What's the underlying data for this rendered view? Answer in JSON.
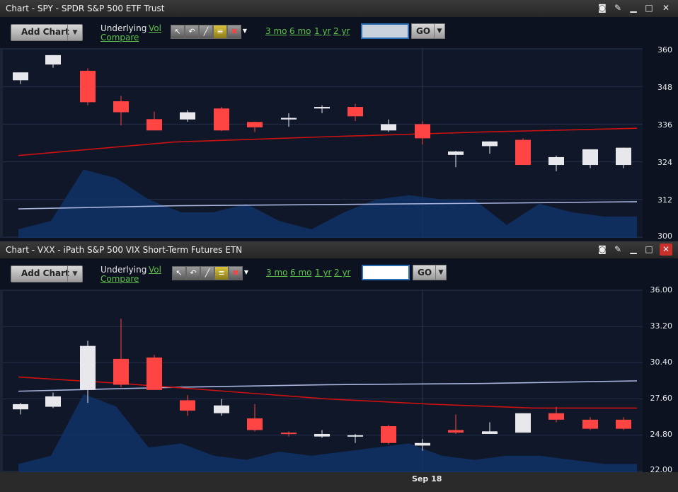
{
  "panels": [
    {
      "title": "Chart - SPY - SPDR S&P 500 ETF Trust",
      "add_chart": "Add Chart",
      "underlying": "Underlying",
      "vol": "Vol",
      "compare": "Compare",
      "periods": [
        "3 mo",
        "6 mo",
        "1 yr",
        "2 yr"
      ],
      "symbol_value": "",
      "go": "GO",
      "y_ticks": [
        "360",
        "348",
        "336",
        "324",
        "312",
        "300"
      ]
    },
    {
      "title": "Chart - VXX - iPath S&P 500 VIX Short-Term Futures ETN",
      "add_chart": "Add Chart",
      "underlying": "Underlying",
      "vol": "Vol",
      "compare": "Compare",
      "periods": [
        "3 mo",
        "6 mo",
        "1 yr",
        "2 yr"
      ],
      "symbol_value": "",
      "go": "GO",
      "y_ticks": [
        "36.00",
        "33.20",
        "30.40",
        "27.60",
        "24.80",
        "22.00"
      ]
    }
  ],
  "x_axis_label": "Sep 18",
  "colors": {
    "up": "#e8e8ec",
    "down": "#ff4444",
    "ma_red": "#cc1111",
    "ma_blue": "#a9b4dd",
    "volume": "#113266",
    "link": "#5ec24b"
  },
  "chart_data": [
    {
      "type": "candlestick",
      "symbol": "SPY",
      "ylim": [
        300,
        360
      ],
      "x_ticks": [
        "Sep 18"
      ],
      "candles": [
        {
          "o": 350.0,
          "h": 351.5,
          "l": 348.8,
          "c": 352.5
        },
        {
          "o": 355.0,
          "h": 358.0,
          "l": 354.0,
          "c": 358.0
        },
        {
          "o": 353.0,
          "h": 353.8,
          "l": 342.0,
          "c": 343.0
        },
        {
          "o": 343.3,
          "h": 345.0,
          "l": 335.6,
          "c": 339.8
        },
        {
          "o": 337.6,
          "h": 340.0,
          "l": 334.3,
          "c": 334.0
        },
        {
          "o": 337.5,
          "h": 340.5,
          "l": 336.8,
          "c": 339.8
        },
        {
          "o": 341.0,
          "h": 341.5,
          "l": 333.8,
          "c": 334.0
        },
        {
          "o": 336.7,
          "h": 336.8,
          "l": 333.5,
          "c": 335.0
        },
        {
          "o": 337.5,
          "h": 339.5,
          "l": 335.2,
          "c": 338.0
        },
        {
          "o": 341.0,
          "h": 342.0,
          "l": 339.5,
          "c": 341.5
        },
        {
          "o": 341.5,
          "h": 342.5,
          "l": 337.0,
          "c": 338.5
        },
        {
          "o": 334.0,
          "h": 337.5,
          "l": 333.5,
          "c": 336.0
        },
        {
          "o": 336.0,
          "h": 337.0,
          "l": 329.5,
          "c": 331.5
        },
        {
          "o": 326.2,
          "h": 327.5,
          "l": 322.3,
          "c": 327.3
        },
        {
          "o": 329.0,
          "h": 330.5,
          "l": 326.6,
          "c": 330.5
        },
        {
          "o": 331.0,
          "h": 331.5,
          "l": 323.0,
          "c": 323.0
        },
        {
          "o": 323.0,
          "h": 326.0,
          "l": 321.0,
          "c": 325.5
        },
        {
          "o": 323.0,
          "h": 328.0,
          "l": 322.0,
          "c": 328.0
        },
        {
          "o": 323.0,
          "h": 328.5,
          "l": 322.0,
          "c": 328.5
        }
      ],
      "ma_red": [
        326.0,
        330.3,
        332.0,
        333.5,
        334.7
      ],
      "ma_blue": [
        309.0,
        310.0,
        310.4,
        310.8,
        311.3
      ],
      "volume": [
        0.1,
        0.2,
        0.8,
        0.7,
        0.45,
        0.3,
        0.3,
        0.4,
        0.2,
        0.1,
        0.3,
        0.45,
        0.5,
        0.45,
        0.45,
        0.15,
        0.4,
        0.3,
        0.25,
        0.25
      ]
    },
    {
      "type": "candlestick",
      "symbol": "VXX",
      "ylim": [
        22,
        36
      ],
      "x_ticks": [
        "Sep 18"
      ],
      "candles": [
        {
          "o": 26.8,
          "h": 27.3,
          "l": 26.4,
          "c": 27.2
        },
        {
          "o": 27.0,
          "h": 28.1,
          "l": 26.9,
          "c": 27.8
        },
        {
          "o": 28.3,
          "h": 32.1,
          "l": 27.3,
          "c": 31.7
        },
        {
          "o": 30.7,
          "h": 33.8,
          "l": 28.5,
          "c": 28.7
        },
        {
          "o": 30.8,
          "h": 31.0,
          "l": 28.4,
          "c": 28.3
        },
        {
          "o": 27.5,
          "h": 27.9,
          "l": 26.3,
          "c": 26.7
        },
        {
          "o": 26.5,
          "h": 27.6,
          "l": 26.3,
          "c": 27.1
        },
        {
          "o": 26.1,
          "h": 27.2,
          "l": 25.1,
          "c": 25.2
        },
        {
          "o": 25.0,
          "h": 25.1,
          "l": 24.7,
          "c": 24.9
        },
        {
          "o": 24.7,
          "h": 25.2,
          "l": 24.6,
          "c": 24.9
        },
        {
          "o": 24.7,
          "h": 24.9,
          "l": 24.2,
          "c": 24.8
        },
        {
          "o": 25.5,
          "h": 25.6,
          "l": 24.1,
          "c": 24.2
        },
        {
          "o": 24.0,
          "h": 24.5,
          "l": 23.6,
          "c": 24.2
        },
        {
          "o": 25.2,
          "h": 26.4,
          "l": 24.9,
          "c": 25.0
        },
        {
          "o": 24.9,
          "h": 25.8,
          "l": 24.9,
          "c": 25.1
        },
        {
          "o": 25.0,
          "h": 26.5,
          "l": 25.0,
          "c": 26.5
        },
        {
          "o": 26.5,
          "h": 27.0,
          "l": 25.8,
          "c": 26.0
        },
        {
          "o": 26.0,
          "h": 26.2,
          "l": 25.2,
          "c": 25.3
        },
        {
          "o": 26.0,
          "h": 26.2,
          "l": 25.2,
          "c": 25.3
        }
      ],
      "ma_red": [
        29.3,
        28.8,
        28.2,
        27.6,
        27.2,
        26.9,
        26.9
      ],
      "ma_blue": [
        28.2,
        28.5,
        28.7,
        28.8,
        29.0
      ],
      "volume": [
        0.1,
        0.2,
        0.95,
        0.8,
        0.3,
        0.35,
        0.2,
        0.15,
        0.25,
        0.2,
        0.25,
        0.3,
        0.35,
        0.2,
        0.15,
        0.2,
        0.2,
        0.15,
        0.1,
        0.1
      ]
    }
  ]
}
